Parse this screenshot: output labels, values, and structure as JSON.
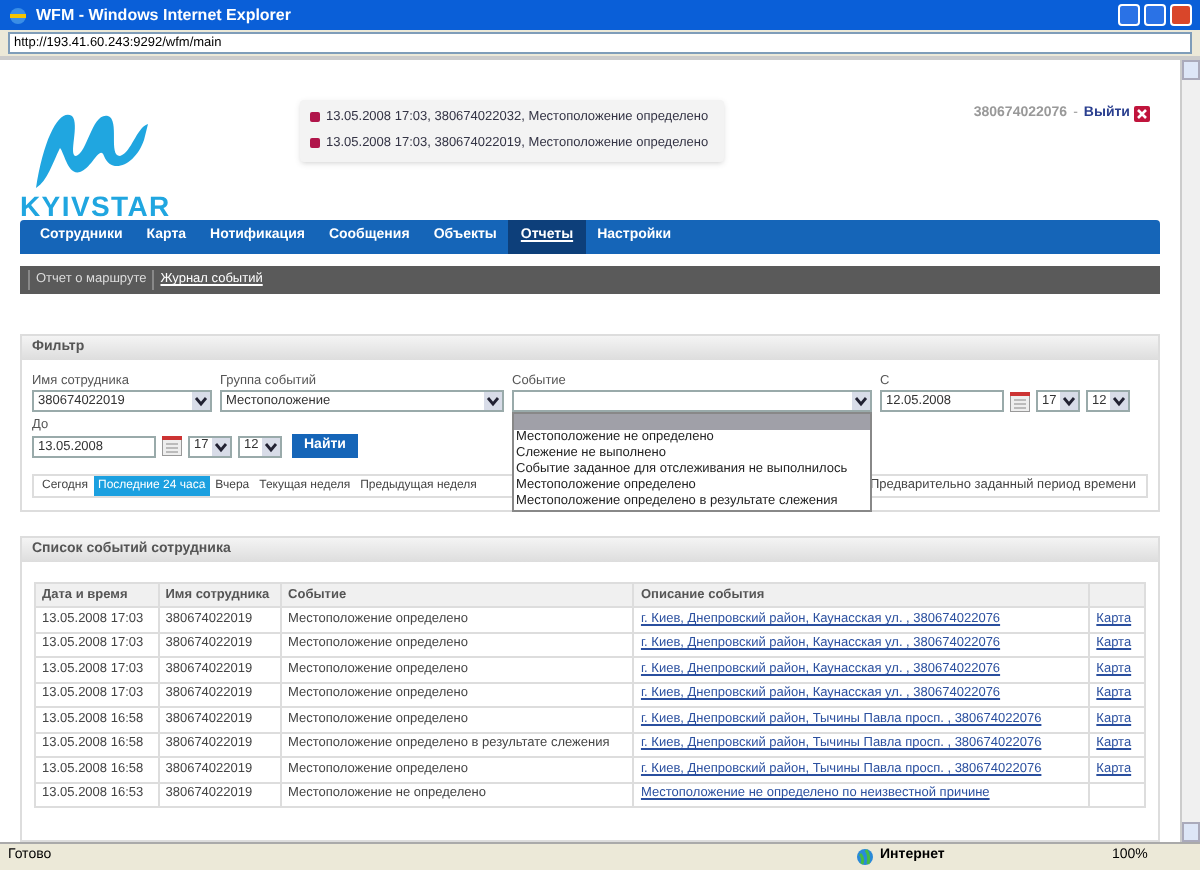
{
  "window": {
    "title": "WFM - Windows Internet Explorer",
    "address": "http://193.41.60.243:9292/wfm/main"
  },
  "header": {
    "logo": "KYIVSTAR",
    "user": "380674022076",
    "separator": "-",
    "logout": "Выйти",
    "notifications": [
      "13.05.2008 17:03, 380674022032, Местоположение определено",
      "13.05.2008 17:03, 380674022019, Местоположение определено"
    ]
  },
  "nav": [
    {
      "label": "Сотрудники",
      "selected": false
    },
    {
      "label": "Карта",
      "selected": false
    },
    {
      "label": "Нотификация",
      "selected": false
    },
    {
      "label": "Сообщения",
      "selected": false
    },
    {
      "label": "Объекты",
      "selected": false
    },
    {
      "label": "Отчеты",
      "selected": true
    },
    {
      "label": "Настройки",
      "selected": false
    }
  ],
  "subnav": [
    {
      "label": "Отчет о маршруте",
      "selected": false
    },
    {
      "label": "Журнал событий",
      "selected": true
    }
  ],
  "filter": {
    "title": "Фильтр",
    "employee": {
      "label": "Имя сотрудника",
      "value": "380674022019"
    },
    "group": {
      "label": "Группа событий",
      "value": "Местоположение"
    },
    "event": {
      "label": "Событие",
      "options": [
        "Местоположение не определено",
        "Слежение не выполнено",
        "Событие заданное для отслеживания не выполнилось",
        "Местоположение определено",
        "Местоположение определено в результате слежения"
      ]
    },
    "from": {
      "label": "С",
      "date": "12.05.2008",
      "hour": "17",
      "minute": "12"
    },
    "to": {
      "label": "До",
      "date": "13.05.2008",
      "hour": "17",
      "minute": "12"
    },
    "find": "Найти",
    "periods": [
      {
        "label": "Сегодня",
        "selected": false
      },
      {
        "label": "Последние 24 часа",
        "selected": true
      },
      {
        "label": "Вчера",
        "selected": false
      },
      {
        "label": "Текущая неделя",
        "selected": false
      },
      {
        "label": "Предыдущая неделя",
        "selected": false
      }
    ],
    "custom_period": "Предварительно заданный период времени"
  },
  "events": {
    "title": "Список событий сотрудника",
    "columns": [
      "Дата и время",
      "Имя сотрудника",
      "Событие",
      "Описание события"
    ],
    "rows": [
      {
        "date": "13.05.2008 17:03",
        "name": "380674022019",
        "event": "Местоположение определено",
        "description": "г. Киев, Днепровский район, Каунасская ул. , 380674022076",
        "map": "Карта"
      },
      {
        "date": "13.05.2008 17:03",
        "name": "380674022019",
        "event": "Местоположение определено",
        "description": "г. Киев, Днепровский район, Каунасская ул. , 380674022076",
        "map": "Карта"
      },
      {
        "date": "13.05.2008 17:03",
        "name": "380674022019",
        "event": "Местоположение определено",
        "description": "г. Киев, Днепровский район, Каунасская ул. , 380674022076",
        "map": "Карта"
      },
      {
        "date": "13.05.2008 17:03",
        "name": "380674022019",
        "event": "Местоположение определено",
        "description": "г. Киев, Днепровский район, Каунасская ул. , 380674022076",
        "map": "Карта"
      },
      {
        "date": "13.05.2008 16:58",
        "name": "380674022019",
        "event": "Местоположение определено",
        "description": "г. Киев, Днепровский район, Тычины Павла просп. , 380674022076",
        "map": "Карта"
      },
      {
        "date": "13.05.2008 16:58",
        "name": "380674022019",
        "event": "Местоположение определено в результате слежения",
        "description": "г. Киев, Днепровский район, Тычины Павла просп. , 380674022076",
        "map": "Карта"
      },
      {
        "date": "13.05.2008 16:58",
        "name": "380674022019",
        "event": "Местоположение определено",
        "description": "г. Киев, Днепровский район, Тычины Павла просп. , 380674022076",
        "map": "Карта"
      },
      {
        "date": "13.05.2008 16:53",
        "name": "380674022019",
        "event": "Местоположение не определено",
        "description": "Местоположение не определено по неизвестной причине"
      }
    ]
  },
  "status_bar": {
    "text": "Готово",
    "zone": "Интернет",
    "zoom": "100%"
  }
}
